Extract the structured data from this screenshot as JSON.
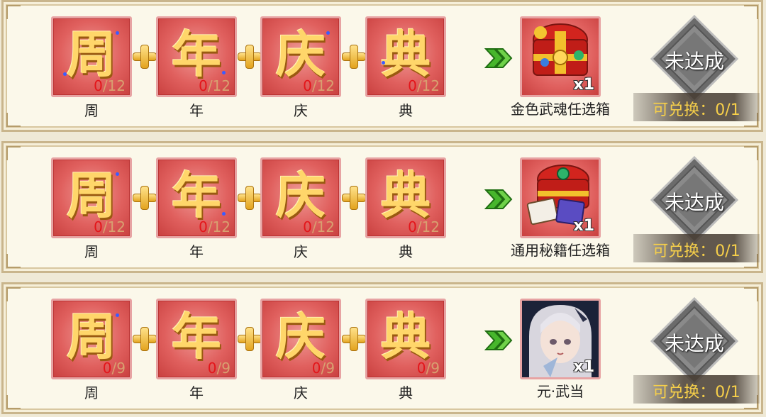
{
  "tile_labels": [
    "周",
    "年",
    "庆",
    "典"
  ],
  "rows": [
    {
      "counts": [
        {
          "have": "0",
          "need": "/12"
        },
        {
          "have": "0",
          "need": "/12"
        },
        {
          "have": "0",
          "need": "/12"
        },
        {
          "have": "0",
          "need": "/12"
        }
      ],
      "reward": {
        "name": "金色武魂任选箱",
        "qty": "x1",
        "icon": "gold-chest-icon"
      },
      "status": "未达成",
      "exchange": "可兑换：0/1"
    },
    {
      "counts": [
        {
          "have": "0",
          "need": "/12"
        },
        {
          "have": "0",
          "need": "/12"
        },
        {
          "have": "0",
          "need": "/12"
        },
        {
          "have": "0",
          "need": "/12"
        }
      ],
      "reward": {
        "name": "通用秘籍任选箱",
        "qty": "x1",
        "icon": "book-chest-icon"
      },
      "status": "未达成",
      "exchange": "可兑换：0/1"
    },
    {
      "counts": [
        {
          "have": "0",
          "need": "/9"
        },
        {
          "have": "0",
          "need": "/9"
        },
        {
          "have": "0",
          "need": "/9"
        },
        {
          "have": "0",
          "need": "/9"
        }
      ],
      "reward": {
        "name": "元·武当",
        "qty": "x1",
        "icon": "character-portrait"
      },
      "status": "未达成",
      "exchange": "可兑换：0/1"
    }
  ]
}
